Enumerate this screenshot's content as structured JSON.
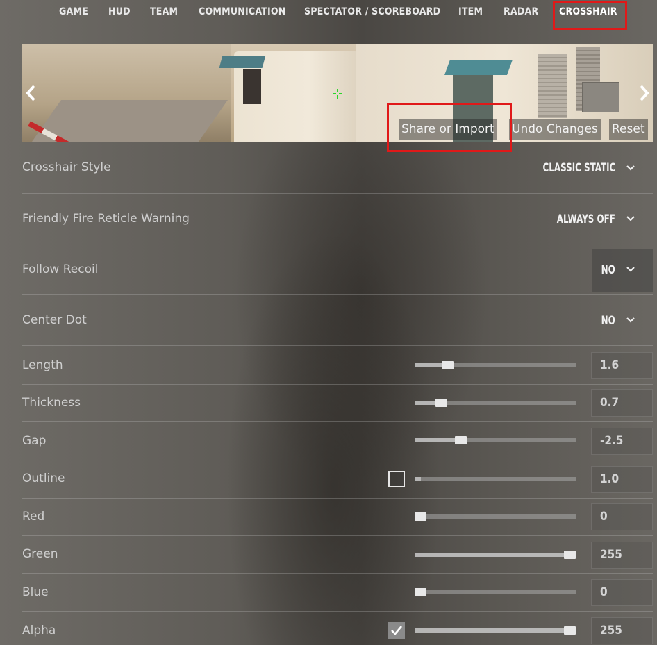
{
  "nav": {
    "tabs": [
      {
        "label": "GAME"
      },
      {
        "label": "HUD"
      },
      {
        "label": "TEAM"
      },
      {
        "label": "COMMUNICATION"
      },
      {
        "label": "SPECTATOR / SCOREBOARD"
      },
      {
        "label": "ITEM"
      },
      {
        "label": "RADAR"
      },
      {
        "label": "CROSSHAIR"
      }
    ],
    "active_tab": "CROSSHAIR"
  },
  "preview": {
    "share_label": "Share or Import",
    "undo_label": "Undo Changes",
    "reset_label": "Reset",
    "prev_icon": "chevron-left-icon",
    "next_icon": "chevron-right-icon",
    "crosshair_color": "#2bd62b"
  },
  "settings": {
    "crosshair_style": {
      "label": "Crosshair Style",
      "value": "CLASSIC STATIC"
    },
    "friendly_fire": {
      "label": "Friendly Fire Reticle Warning",
      "value": "ALWAYS OFF"
    },
    "follow_recoil": {
      "label": "Follow Recoil",
      "value": "NO"
    },
    "center_dot": {
      "label": "Center Dot",
      "value": "NO"
    },
    "sliders": [
      {
        "label": "Length",
        "value": "1.6",
        "fraction": 0.18
      },
      {
        "label": "Thickness",
        "value": "0.7",
        "fraction": 0.14
      },
      {
        "label": "Gap",
        "value": "-2.5",
        "fraction": 0.27
      },
      {
        "label": "Outline",
        "value": "1.0",
        "fraction": 0.0,
        "checkbox": false
      },
      {
        "label": "Red",
        "value": "0",
        "fraction": 0.0
      },
      {
        "label": "Green",
        "value": "255",
        "fraction": 1.0
      },
      {
        "label": "Blue",
        "value": "0",
        "fraction": 0.0
      },
      {
        "label": "Alpha",
        "value": "255",
        "fraction": 1.0,
        "checkbox": true
      }
    ]
  },
  "highlight_color": "#e01919"
}
